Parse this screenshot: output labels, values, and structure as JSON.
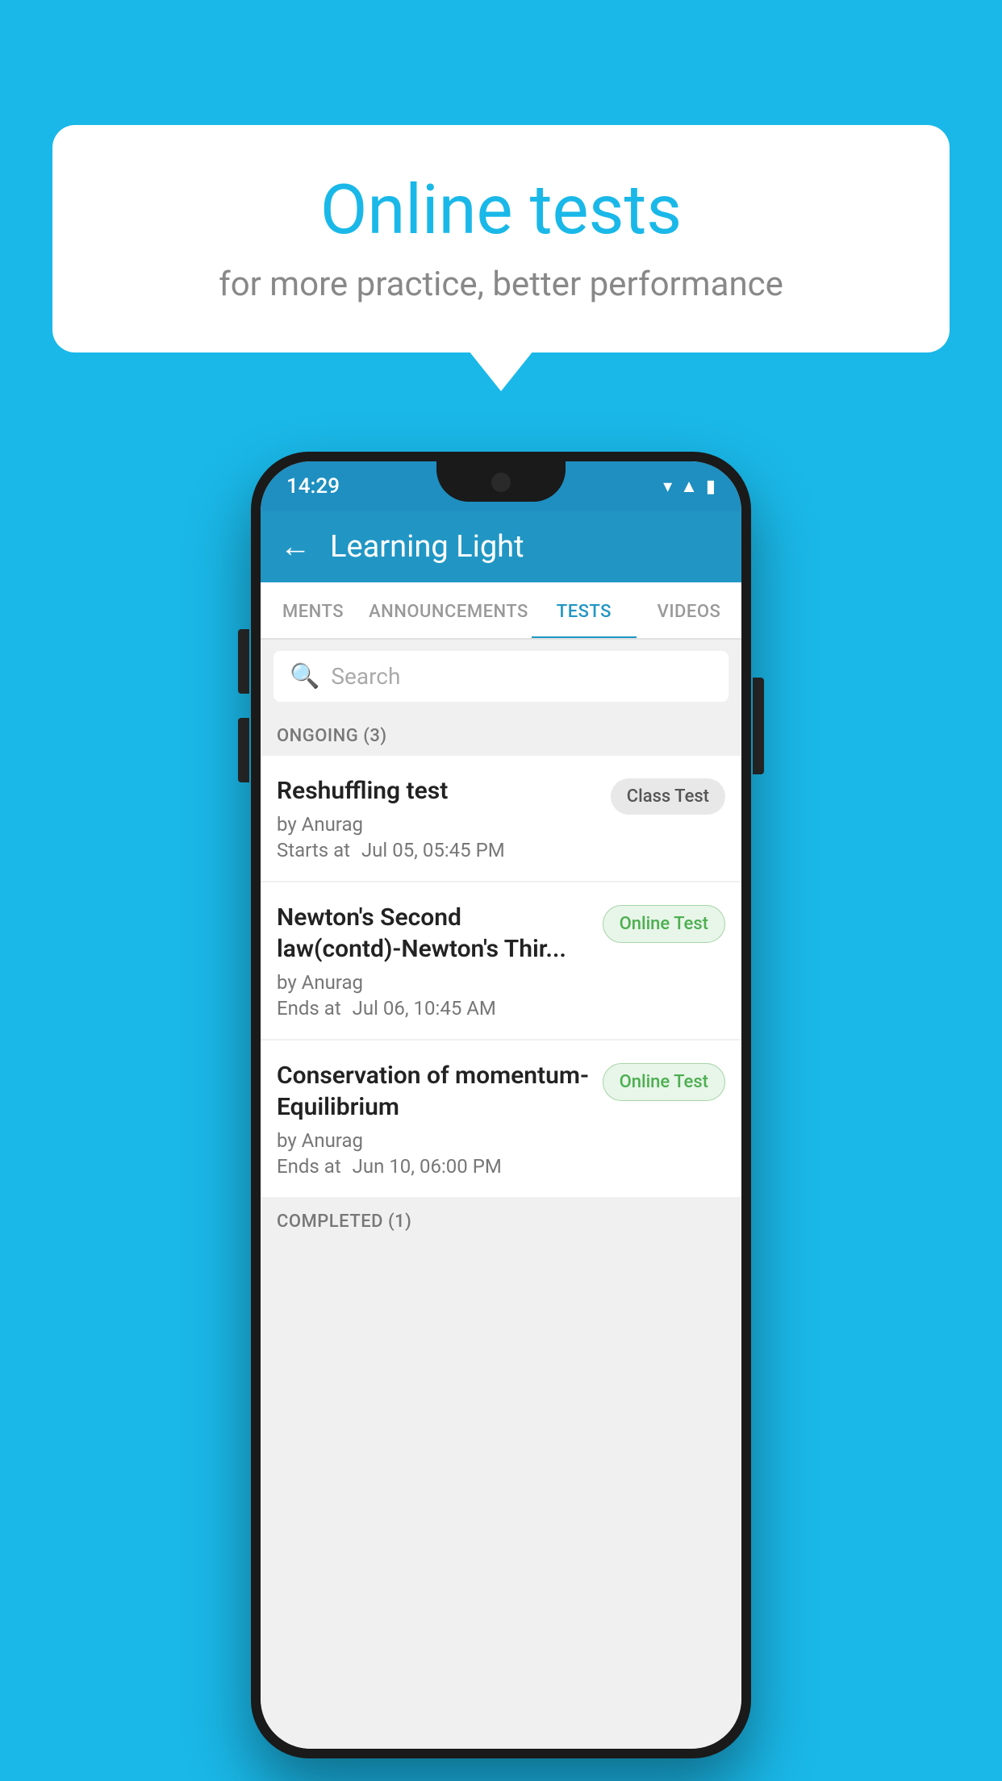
{
  "background": {
    "color": "#1ab8e8"
  },
  "bubble": {
    "title": "Online tests",
    "subtitle": "for more practice, better performance"
  },
  "phone": {
    "status_bar": {
      "time": "14:29",
      "icons": [
        "wifi",
        "signal",
        "battery"
      ]
    },
    "header": {
      "title": "Learning Light",
      "back_label": "←"
    },
    "tabs": [
      {
        "label": "MENTS",
        "active": false
      },
      {
        "label": "ANNOUNCEMENTS",
        "active": false
      },
      {
        "label": "TESTS",
        "active": true
      },
      {
        "label": "VIDEOS",
        "active": false
      }
    ],
    "search": {
      "placeholder": "Search"
    },
    "ongoing_section": {
      "label": "ONGOING (3)"
    },
    "test_items": [
      {
        "name": "Reshuffling test",
        "author": "by Anurag",
        "date_label": "Starts at",
        "date": "Jul 05, 05:45 PM",
        "badge": "Class Test",
        "badge_type": "class"
      },
      {
        "name": "Newton's Second law(contd)-Newton's Thir...",
        "author": "by Anurag",
        "date_label": "Ends at",
        "date": "Jul 06, 10:45 AM",
        "badge": "Online Test",
        "badge_type": "online"
      },
      {
        "name": "Conservation of momentum-Equilibrium",
        "author": "by Anurag",
        "date_label": "Ends at",
        "date": "Jun 10, 06:00 PM",
        "badge": "Online Test",
        "badge_type": "online"
      }
    ],
    "completed_section": {
      "label": "COMPLETED (1)"
    }
  }
}
